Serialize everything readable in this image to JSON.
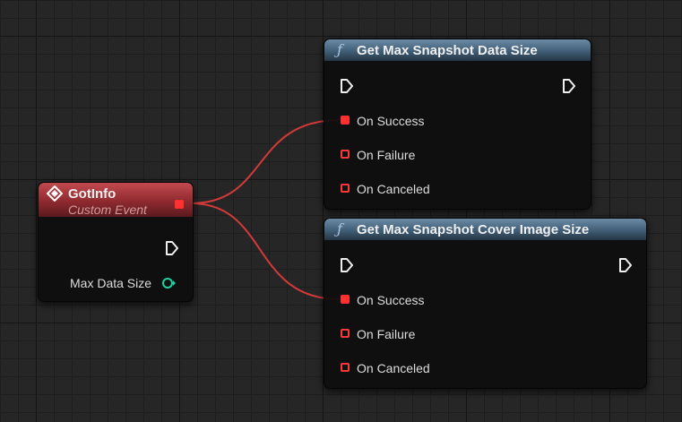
{
  "event_node": {
    "title": "GotInfo",
    "subtitle": "Custom Event",
    "output_label": "Max Data Size"
  },
  "function_nodes": [
    {
      "title": "Get Max Snapshot Data Size",
      "pins": [
        "On Success",
        "On Failure",
        "On Canceled"
      ]
    },
    {
      "title": "Get Max Snapshot Cover Image Size",
      "pins": [
        "On Success",
        "On Failure",
        "On Canceled"
      ]
    }
  ],
  "icons": {
    "function": "function-icon",
    "event": "event-diamond-icon"
  },
  "colors": {
    "event_header": "#9e2f35",
    "function_header": "#4a6a85",
    "delegate_pin": "#ff3030",
    "wire": "#d23a3a",
    "integer_pin": "#1ed2a0"
  }
}
